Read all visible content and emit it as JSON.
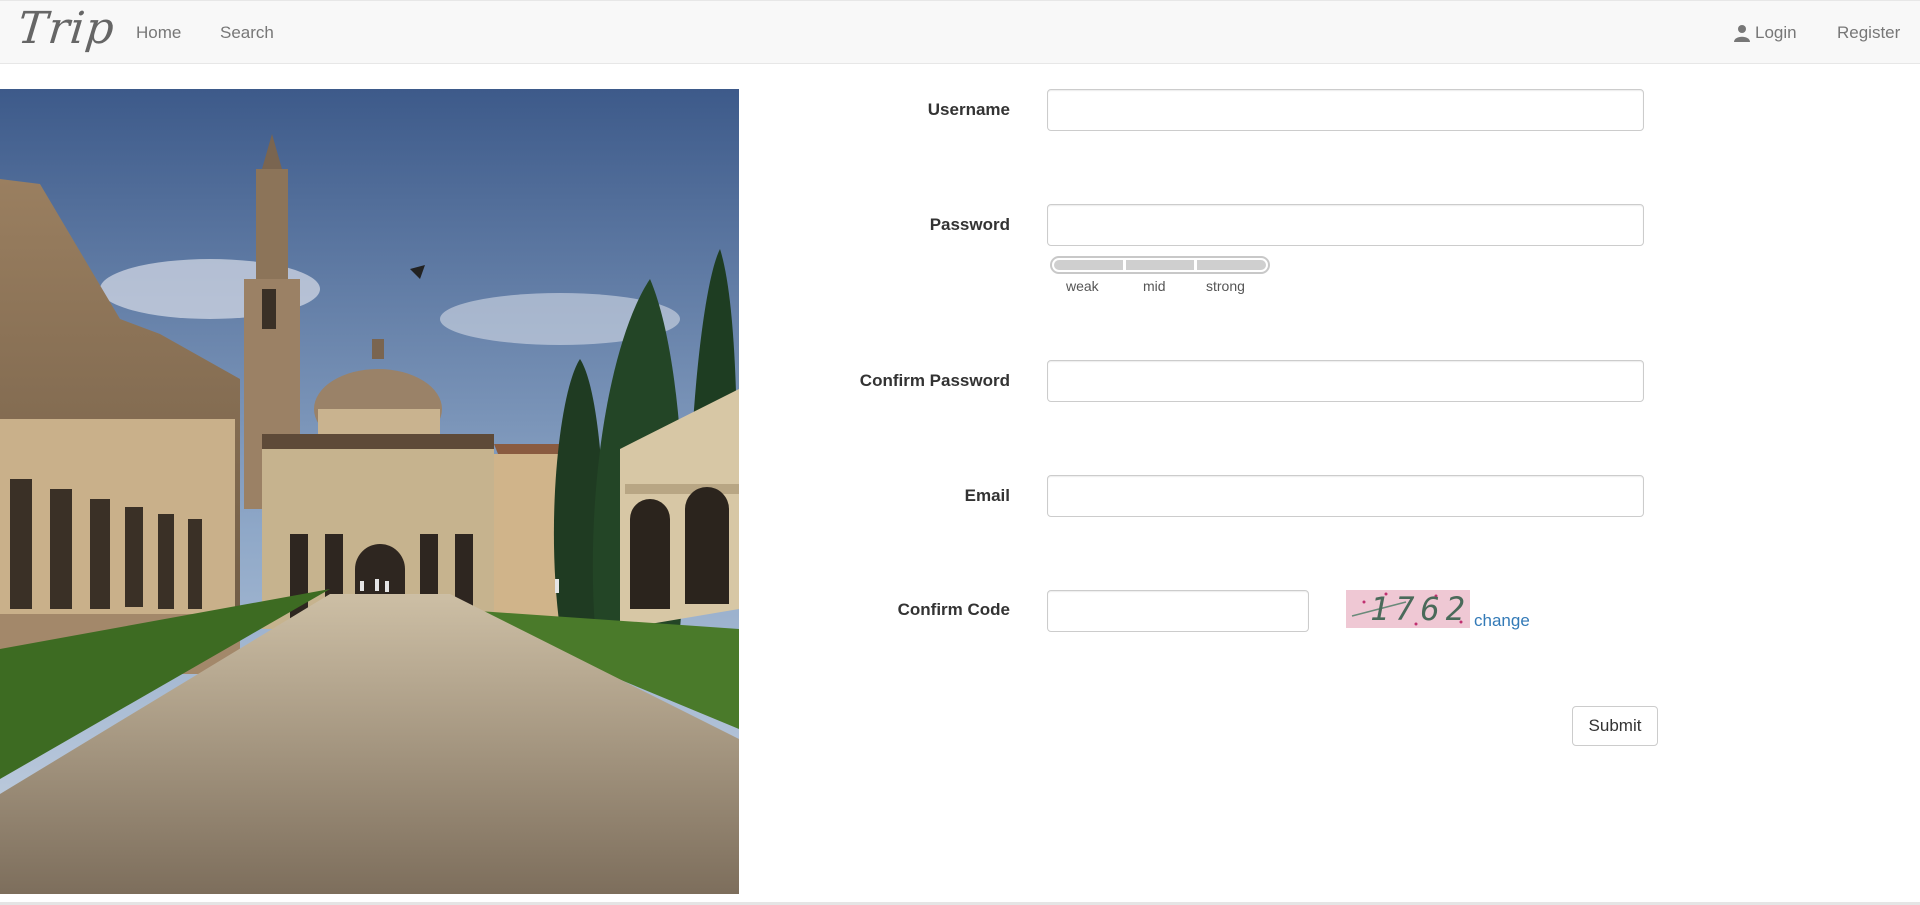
{
  "navbar": {
    "brand": "Trip",
    "links": {
      "home": "Home",
      "search": "Search",
      "login": "Login",
      "register": "Register"
    }
  },
  "form": {
    "username": {
      "label": "Username",
      "value": ""
    },
    "password": {
      "label": "Password",
      "value": "",
      "strength_labels": [
        "weak",
        "mid",
        "strong"
      ]
    },
    "confirm_password": {
      "label": "Confirm Password",
      "value": ""
    },
    "email": {
      "label": "Email",
      "value": ""
    },
    "confirm_code": {
      "label": "Confirm Code",
      "value": "",
      "captcha_text": "1762",
      "change_label": "change"
    },
    "submit_label": "Submit"
  },
  "colors": {
    "navbar_bg": "#f8f8f8",
    "link": "#337ab7",
    "captcha_bg": "#efc8d4"
  },
  "icons": {
    "login": "user-icon"
  }
}
